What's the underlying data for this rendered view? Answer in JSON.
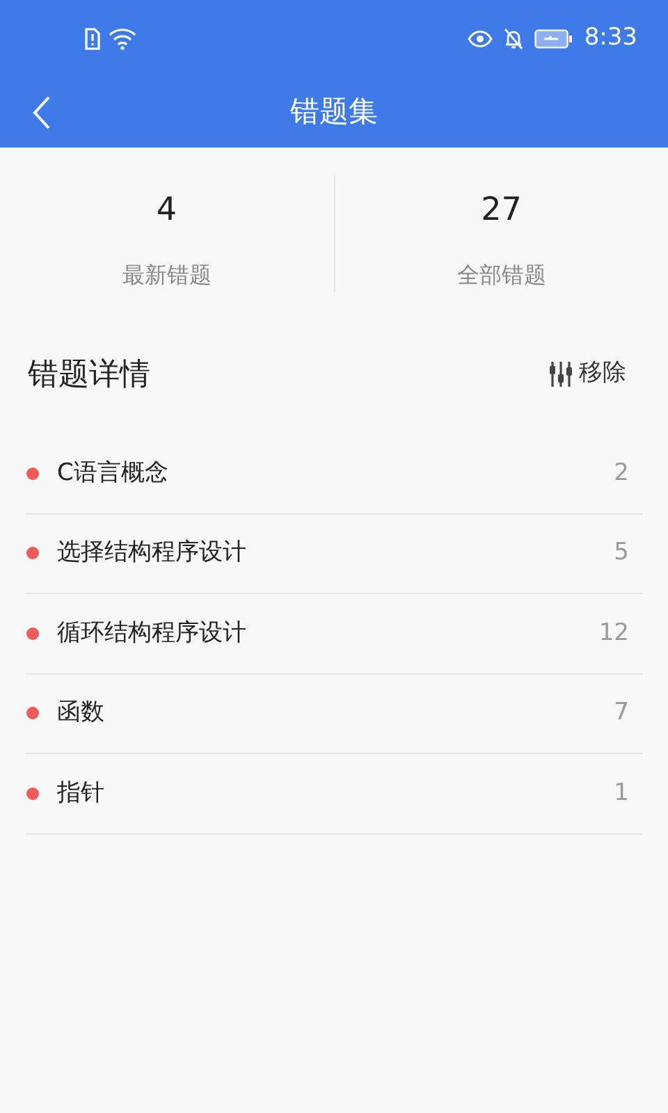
{
  "status_bar": {
    "time": "8:33"
  },
  "header": {
    "title": "错题集"
  },
  "stats": [
    {
      "value": "4",
      "label": "最新错题"
    },
    {
      "value": "27",
      "label": "全部错题"
    }
  ],
  "details": {
    "title": "错题详情",
    "remove_label": "移除"
  },
  "topics": [
    {
      "name": "C语言概念",
      "count": "2"
    },
    {
      "name": "选择结构程序设计",
      "count": "5"
    },
    {
      "name": "循环结构程序设计",
      "count": "12"
    },
    {
      "name": "函数",
      "count": "7"
    },
    {
      "name": "指针",
      "count": "1"
    }
  ]
}
